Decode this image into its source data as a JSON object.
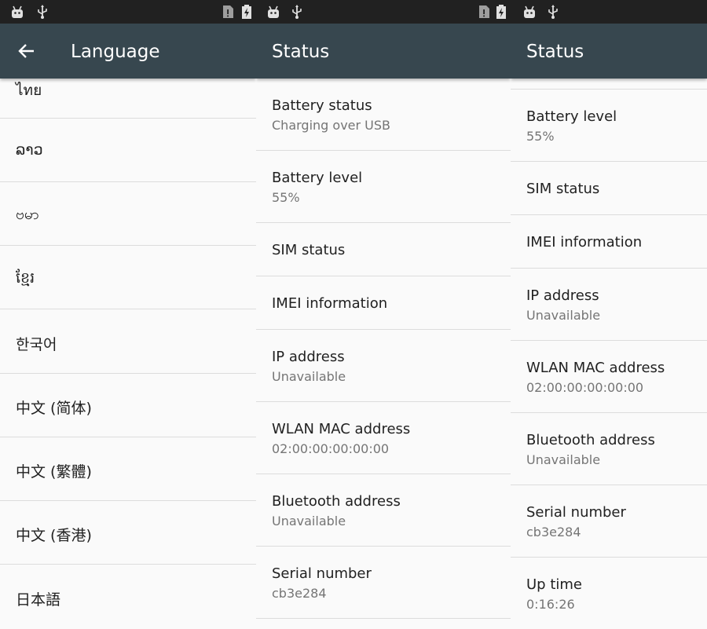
{
  "panel1": {
    "title": "Language",
    "languages": [
      "ไทย",
      "ລາວ",
      "ဗမာ",
      "ខ្មែរ",
      "한국어",
      "中文 (简体)",
      "中文 (繁體)",
      "中文 (香港)",
      "日本語"
    ]
  },
  "panel2": {
    "title": "Status",
    "items": [
      {
        "title": "Battery status",
        "summary": "Charging over USB"
      },
      {
        "title": "Battery level",
        "summary": "55%"
      },
      {
        "title": "SIM status",
        "summary": ""
      },
      {
        "title": "IMEI information",
        "summary": ""
      },
      {
        "title": "IP address",
        "summary": "Unavailable"
      },
      {
        "title": "WLAN MAC address",
        "summary": "02:00:00:00:00:00"
      },
      {
        "title": "Bluetooth address",
        "summary": "Unavailable"
      },
      {
        "title": "Serial number",
        "summary": "cb3e284"
      }
    ]
  },
  "panel3": {
    "title": "Status",
    "items": [
      {
        "title": "Battery level",
        "summary": "55%"
      },
      {
        "title": "SIM status",
        "summary": ""
      },
      {
        "title": "IMEI information",
        "summary": ""
      },
      {
        "title": "IP address",
        "summary": "Unavailable"
      },
      {
        "title": "WLAN MAC address",
        "summary": "02:00:00:00:00:00"
      },
      {
        "title": "Bluetooth address",
        "summary": "Unavailable"
      },
      {
        "title": "Serial number",
        "summary": "cb3e284"
      },
      {
        "title": "Up time",
        "summary": "0:16:26"
      }
    ]
  },
  "colors": {
    "status_bar": "#212121",
    "toolbar": "#37474f",
    "background": "#fafafa",
    "divider": "#dcdcdc",
    "primary_text": "#212121",
    "secondary_text": "#757575"
  },
  "icons": [
    "android-debug-icon",
    "usb-icon",
    "sim-card-alert-icon",
    "battery-charging-icon",
    "back-arrow-icon"
  ]
}
